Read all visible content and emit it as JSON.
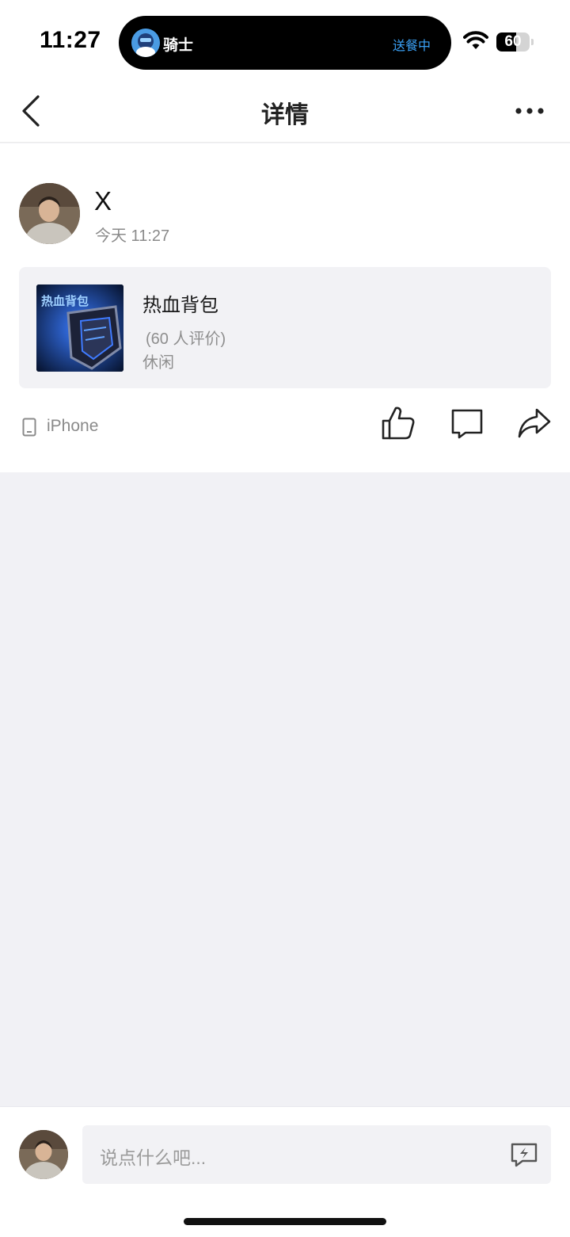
{
  "status_bar": {
    "time": "11:27",
    "live_activity": {
      "title": "骑士",
      "status": "送餐中",
      "status_color": "#3aa0f5"
    },
    "battery": {
      "level": "60",
      "fraction": 0.6
    }
  },
  "nav": {
    "title": "详情"
  },
  "post": {
    "username": "X",
    "timestamp": "今天 11:27",
    "game": {
      "name": "热血背包",
      "rating_text": "(60 人评价)",
      "genre": "休闲",
      "thumb_caption": "热血背包"
    },
    "device": "iPhone"
  },
  "comment_box": {
    "placeholder": "说点什么吧..."
  },
  "colors": {
    "background": "#f1f1f5",
    "card": "#ffffff",
    "muted_text": "#8a8a8a",
    "accent": "#3aa0f5"
  },
  "icons": {
    "back": "chevron-left-icon",
    "more": "ellipsis-icon",
    "like": "thumbs-up-icon",
    "comment": "speech-bubble-icon",
    "share": "share-arrow-icon",
    "device": "phone-icon",
    "quick_reply": "lightning-bubble-icon"
  }
}
